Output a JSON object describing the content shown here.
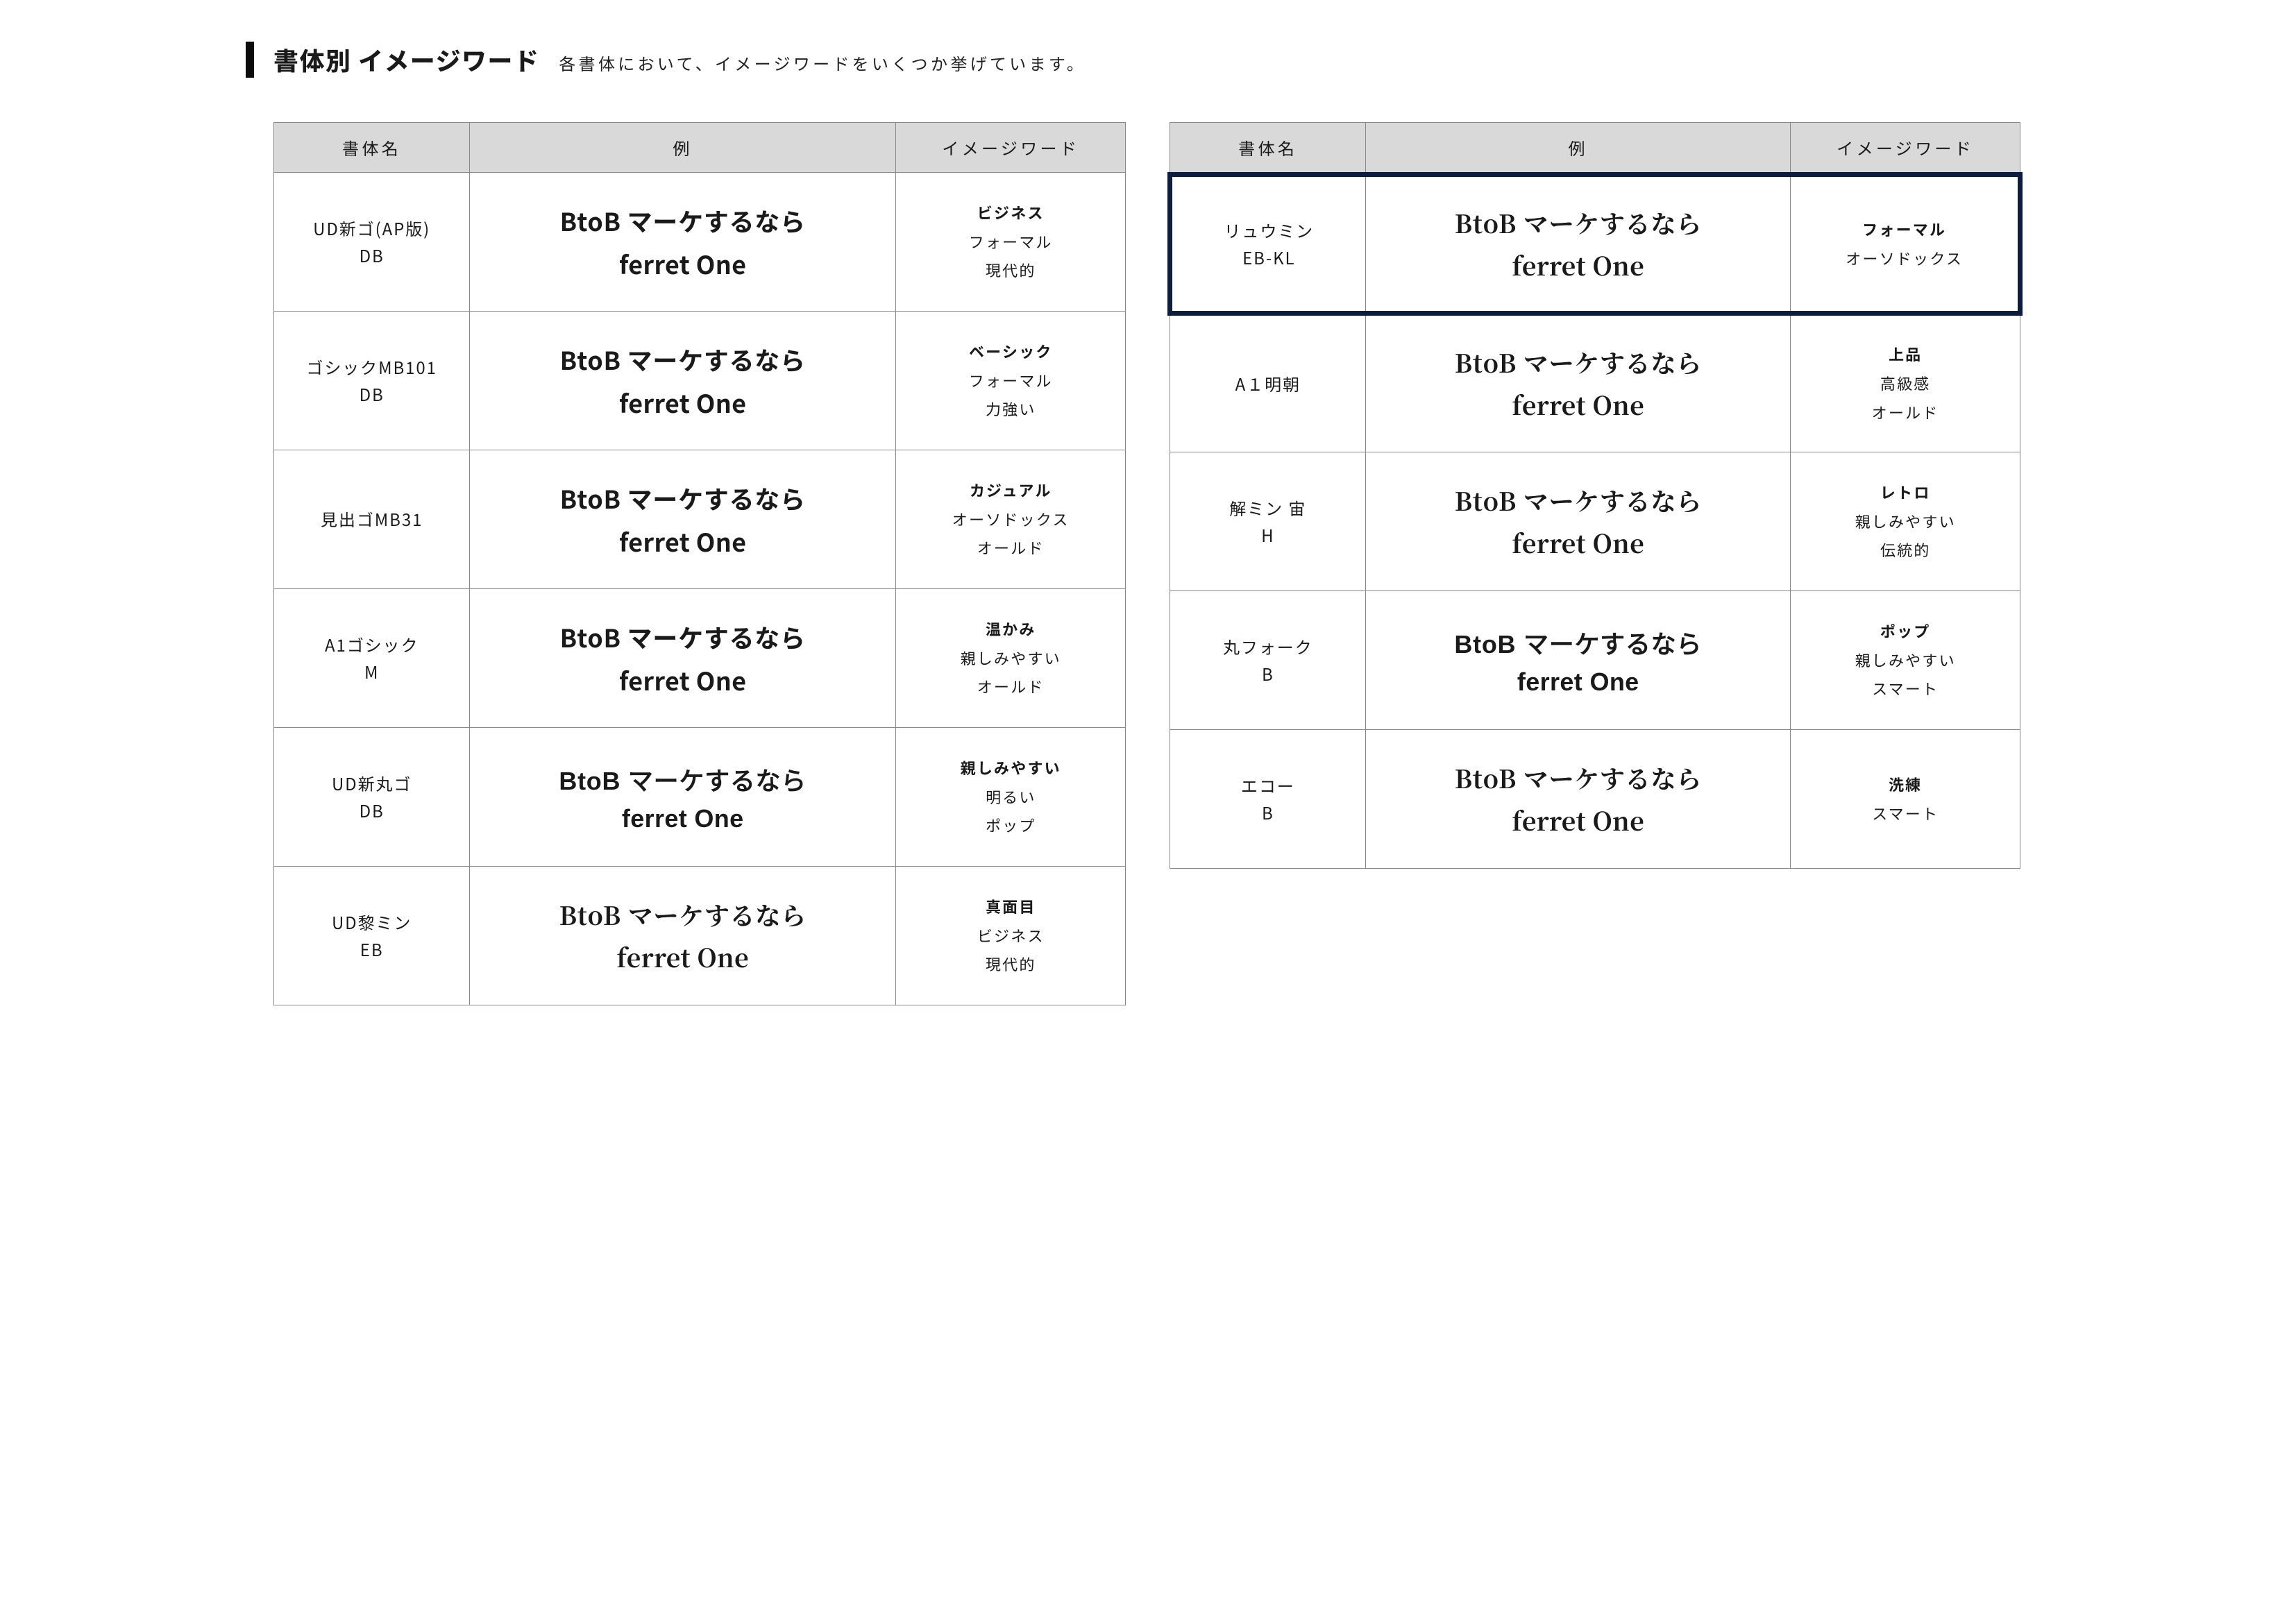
{
  "header": {
    "title": "書体別 イメージワード",
    "subtitle": "各書体において、イメージワードをいくつか挙げています。"
  },
  "columns": {
    "name": "書体名",
    "sample": "例",
    "words": "イメージワード"
  },
  "sample_text": {
    "line1": "BtoB マーケするなら",
    "line2": "ferret One"
  },
  "left": [
    {
      "name_lines": [
        "UD新ゴ(AP版)",
        "DB"
      ],
      "style": "style-sans-heavy",
      "words": [
        {
          "t": "ビジネス",
          "bold": true
        },
        {
          "t": "フォーマル",
          "bold": false
        },
        {
          "t": "現代的",
          "bold": false
        }
      ],
      "highlight": false
    },
    {
      "name_lines": [
        "ゴシックMB101",
        "DB"
      ],
      "style": "style-sans-wide",
      "words": [
        {
          "t": "ベーシック",
          "bold": true
        },
        {
          "t": "フォーマル",
          "bold": false
        },
        {
          "t": "力強い",
          "bold": false
        }
      ],
      "highlight": false
    },
    {
      "name_lines": [
        "見出ゴMB31"
      ],
      "style": "style-sans-heavy",
      "words": [
        {
          "t": "カジュアル",
          "bold": true
        },
        {
          "t": "オーソドックス",
          "bold": false
        },
        {
          "t": "オールド",
          "bold": false
        }
      ],
      "highlight": false
    },
    {
      "name_lines": [
        "A1ゴシック",
        "M"
      ],
      "style": "style-sans-soft",
      "words": [
        {
          "t": "温かみ",
          "bold": true
        },
        {
          "t": "親しみやすい",
          "bold": false
        },
        {
          "t": "オールド",
          "bold": false
        }
      ],
      "highlight": false
    },
    {
      "name_lines": [
        "UD新丸ゴ",
        "DB"
      ],
      "style": "style-round",
      "words": [
        {
          "t": "親しみやすい",
          "bold": true
        },
        {
          "t": "明るい",
          "bold": false
        },
        {
          "t": "ポップ",
          "bold": false
        }
      ],
      "highlight": false
    },
    {
      "name_lines": [
        "UD黎ミン",
        "EB"
      ],
      "style": "style-serif",
      "words": [
        {
          "t": "真面目",
          "bold": true
        },
        {
          "t": "ビジネス",
          "bold": false
        },
        {
          "t": "現代的",
          "bold": false
        }
      ],
      "highlight": false
    }
  ],
  "right": [
    {
      "name_lines": [
        "リュウミン",
        "EB-KL"
      ],
      "style": "style-serif-bold",
      "words": [
        {
          "t": "フォーマル",
          "bold": true
        },
        {
          "t": "オーソドックス",
          "bold": false
        }
      ],
      "highlight": true
    },
    {
      "name_lines": [
        "A１明朝"
      ],
      "style": "style-serif-light",
      "words": [
        {
          "t": "上品",
          "bold": true
        },
        {
          "t": "高級感",
          "bold": false
        },
        {
          "t": "オールド",
          "bold": false
        }
      ],
      "highlight": false
    },
    {
      "name_lines": [
        "解ミン 宙",
        "H"
      ],
      "style": "style-serif-bold",
      "words": [
        {
          "t": "レトロ",
          "bold": true
        },
        {
          "t": "親しみやすい",
          "bold": false
        },
        {
          "t": "伝統的",
          "bold": false
        }
      ],
      "highlight": false
    },
    {
      "name_lines": [
        "丸フォーク",
        "B"
      ],
      "style": "style-round",
      "words": [
        {
          "t": "ポップ",
          "bold": true
        },
        {
          "t": "親しみやすい",
          "bold": false
        },
        {
          "t": "スマート",
          "bold": false
        }
      ],
      "highlight": false
    },
    {
      "name_lines": [
        "エコー",
        "B"
      ],
      "style": "style-serif-light",
      "words": [
        {
          "t": "洗練",
          "bold": true
        },
        {
          "t": "スマート",
          "bold": false
        }
      ],
      "highlight": false
    }
  ]
}
